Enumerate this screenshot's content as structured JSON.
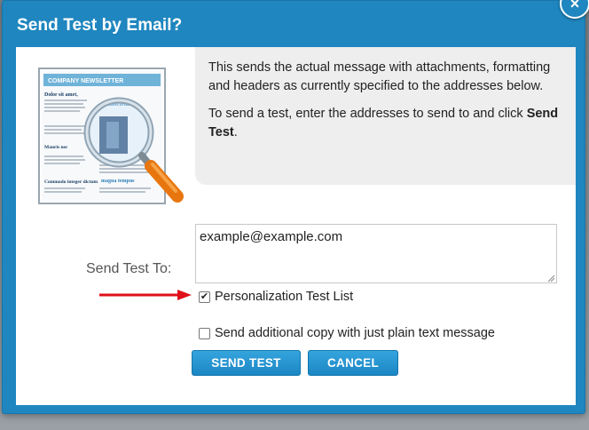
{
  "dialog": {
    "title": "Send Test by Email?",
    "close_label": "×"
  },
  "info": {
    "paragraph1": "This sends the actual message with attachments, formatting and headers as currently specified to the addresses below.",
    "paragraph2_prefix": "To send a test, enter the addresses to send to and click ",
    "paragraph2_bold": "Send Test",
    "paragraph2_suffix": "."
  },
  "illustration": {
    "header": "COMPANY NEWSLETTER",
    "headline1": "Dolor sit amet,",
    "headline2": "Mauris nec",
    "headline3": "Commodo integer dictum",
    "headline4": "consectetur",
    "headline5": "magna tempus",
    "icon": "magnifier-over-newsletter"
  },
  "form": {
    "send_to_label": "Send Test To:",
    "email_value": "example@example.com",
    "personalization_label": "Personalization Test List",
    "personalization_checked": true,
    "plain_text_label": "Send additional copy with just plain text message",
    "plain_text_checked": false
  },
  "buttons": {
    "send_test": "SEND TEST",
    "cancel": "CANCEL"
  },
  "colors": {
    "accent": "#1f86bf",
    "arrow": "#e0101a"
  }
}
